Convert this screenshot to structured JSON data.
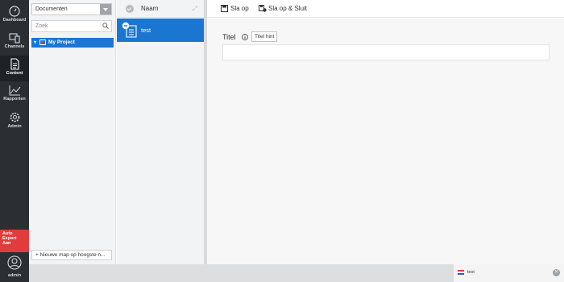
{
  "rail": {
    "items": [
      {
        "label": "Dashboard"
      },
      {
        "label": "Channels"
      },
      {
        "label": "Content"
      },
      {
        "label": "Rapporten"
      },
      {
        "label": "Admin"
      }
    ],
    "alert": {
      "line1": "Auto",
      "line2": "Export",
      "line3": "Aan"
    },
    "user": {
      "label": "admin"
    }
  },
  "tree": {
    "dropdown_value": "Documenten",
    "search_placeholder": "Zoek",
    "root_node": "My Project",
    "new_folder_button": "+ Nieuwe map op hoogste n..."
  },
  "list": {
    "header": "Naam",
    "items": [
      {
        "name": "test"
      }
    ]
  },
  "toolbar": {
    "save": "Sla op",
    "save_close": "Sla op & Sluit"
  },
  "editor": {
    "field_label": "Titel",
    "hint": "Titel hint",
    "field_value": ""
  },
  "statusbar": {
    "language": "test"
  },
  "colors": {
    "rail": "#2b2f33",
    "accent": "#1b76d2",
    "alert": "#e23b3b"
  }
}
